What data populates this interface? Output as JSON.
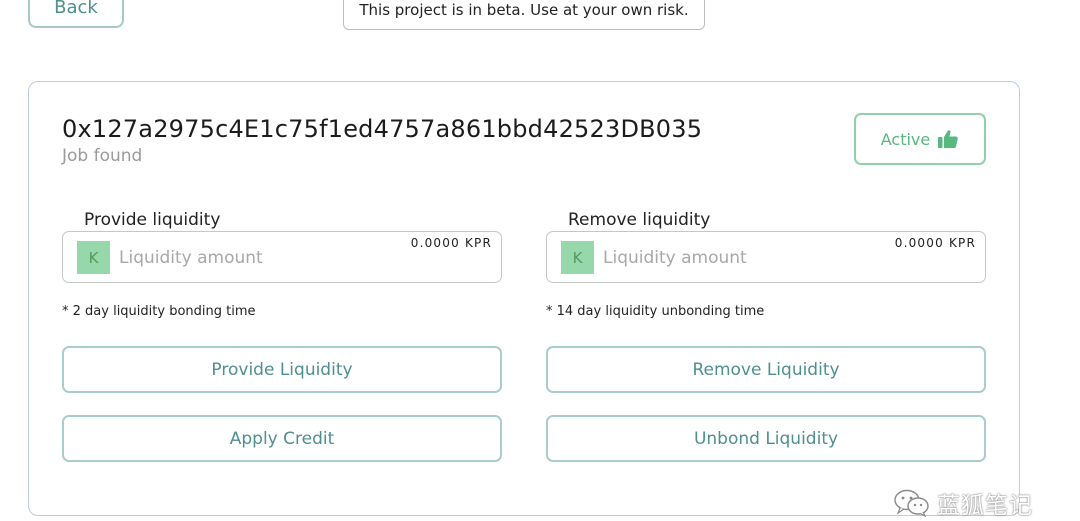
{
  "top_bar": {
    "back_label": "Back",
    "beta_notice": "This project is in beta. Use at your own risk."
  },
  "job": {
    "address": "0x127a2975c4E1c75f1ed4757a861bbd42523DB035",
    "status_text": "Job found",
    "badge_label": "Active",
    "badge_icon": "thumbs-up-icon",
    "accent_color": "#58b980"
  },
  "provide": {
    "label": "Provide liquidity",
    "token_letter": "K",
    "placeholder": "Liquidity amount",
    "value": "",
    "balance": "0.0000 KPR",
    "note": "* 2 day liquidity bonding time"
  },
  "remove": {
    "label": "Remove liquidity",
    "token_letter": "K",
    "placeholder": "Liquidity amount",
    "value": "",
    "balance": "0.0000 KPR",
    "note": "* 14 day liquidity unbonding time"
  },
  "actions": {
    "provide_label": "Provide Liquidity",
    "remove_label": "Remove Liquidity",
    "apply_credit_label": "Apply Credit",
    "unbond_label": "Unbond Liquidity"
  },
  "watermark": {
    "text": "蓝狐笔记",
    "icon": "wechat-icon"
  }
}
